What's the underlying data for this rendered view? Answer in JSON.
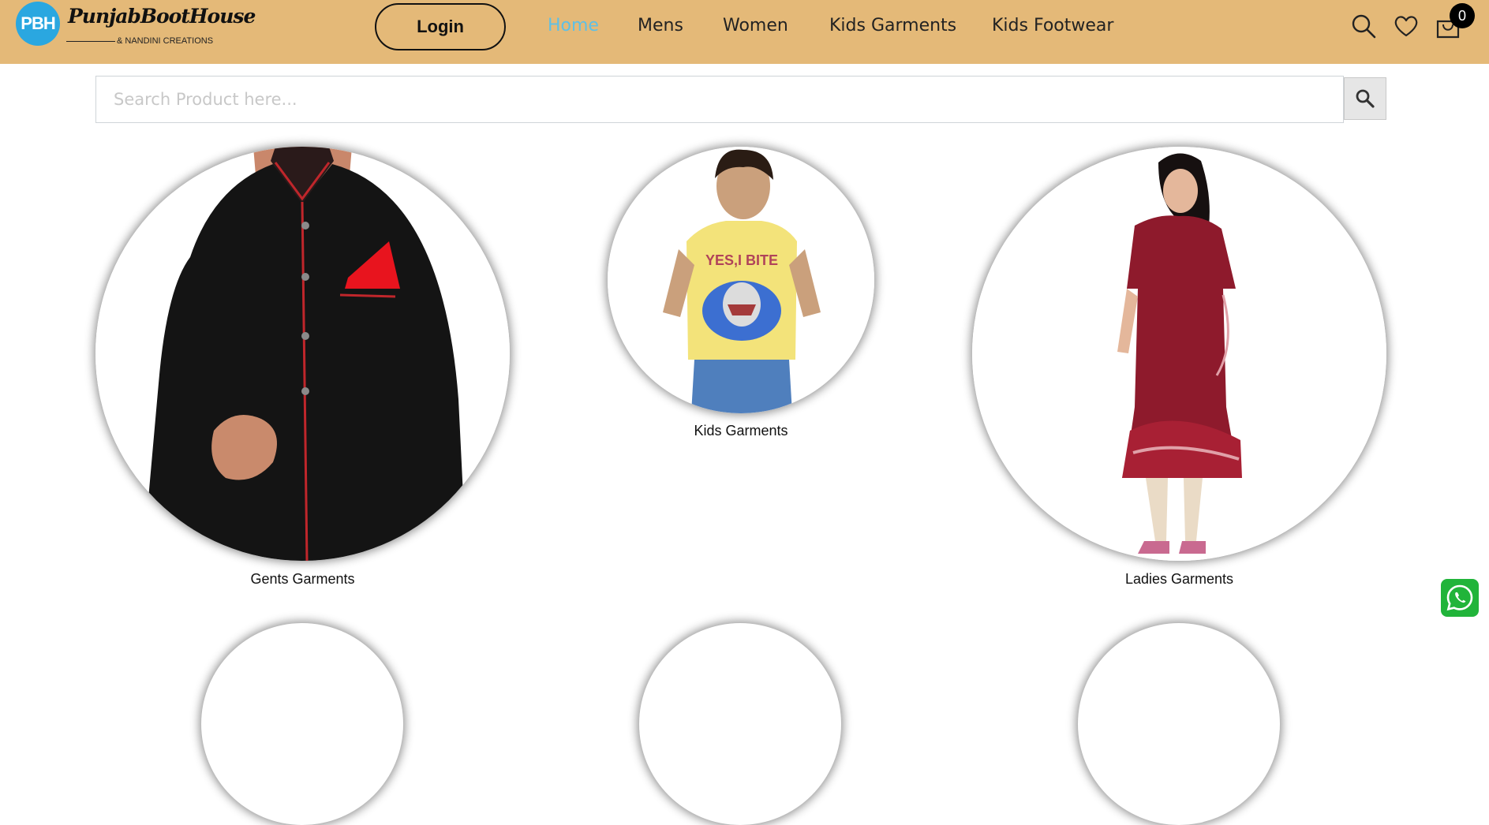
{
  "header": {
    "logo": {
      "badge": "PBH",
      "name": "PunjabBootHouse",
      "subtitle": "& NANDINI CREATIONS"
    },
    "login_label": "Login",
    "nav": [
      {
        "label": "Home",
        "active": true
      },
      {
        "label": "Mens",
        "active": false
      },
      {
        "label": "Women",
        "active": false
      },
      {
        "label": "Kids Garments",
        "active": false
      },
      {
        "label": "Kids Footwear",
        "active": false
      }
    ],
    "icons": [
      "search-icon",
      "heart-icon",
      "cart-icon"
    ],
    "cart_count": "0",
    "active_color": "#5ec0e6",
    "bg_color": "#e4b978"
  },
  "search": {
    "placeholder": "Search Product here...",
    "value": ""
  },
  "categories": [
    {
      "label": "Gents Garments"
    },
    {
      "label": "Kids Garments"
    },
    {
      "label": "Ladies Garments"
    }
  ],
  "floating": {
    "icon": "whatsapp-icon",
    "color": "#21b43a"
  }
}
